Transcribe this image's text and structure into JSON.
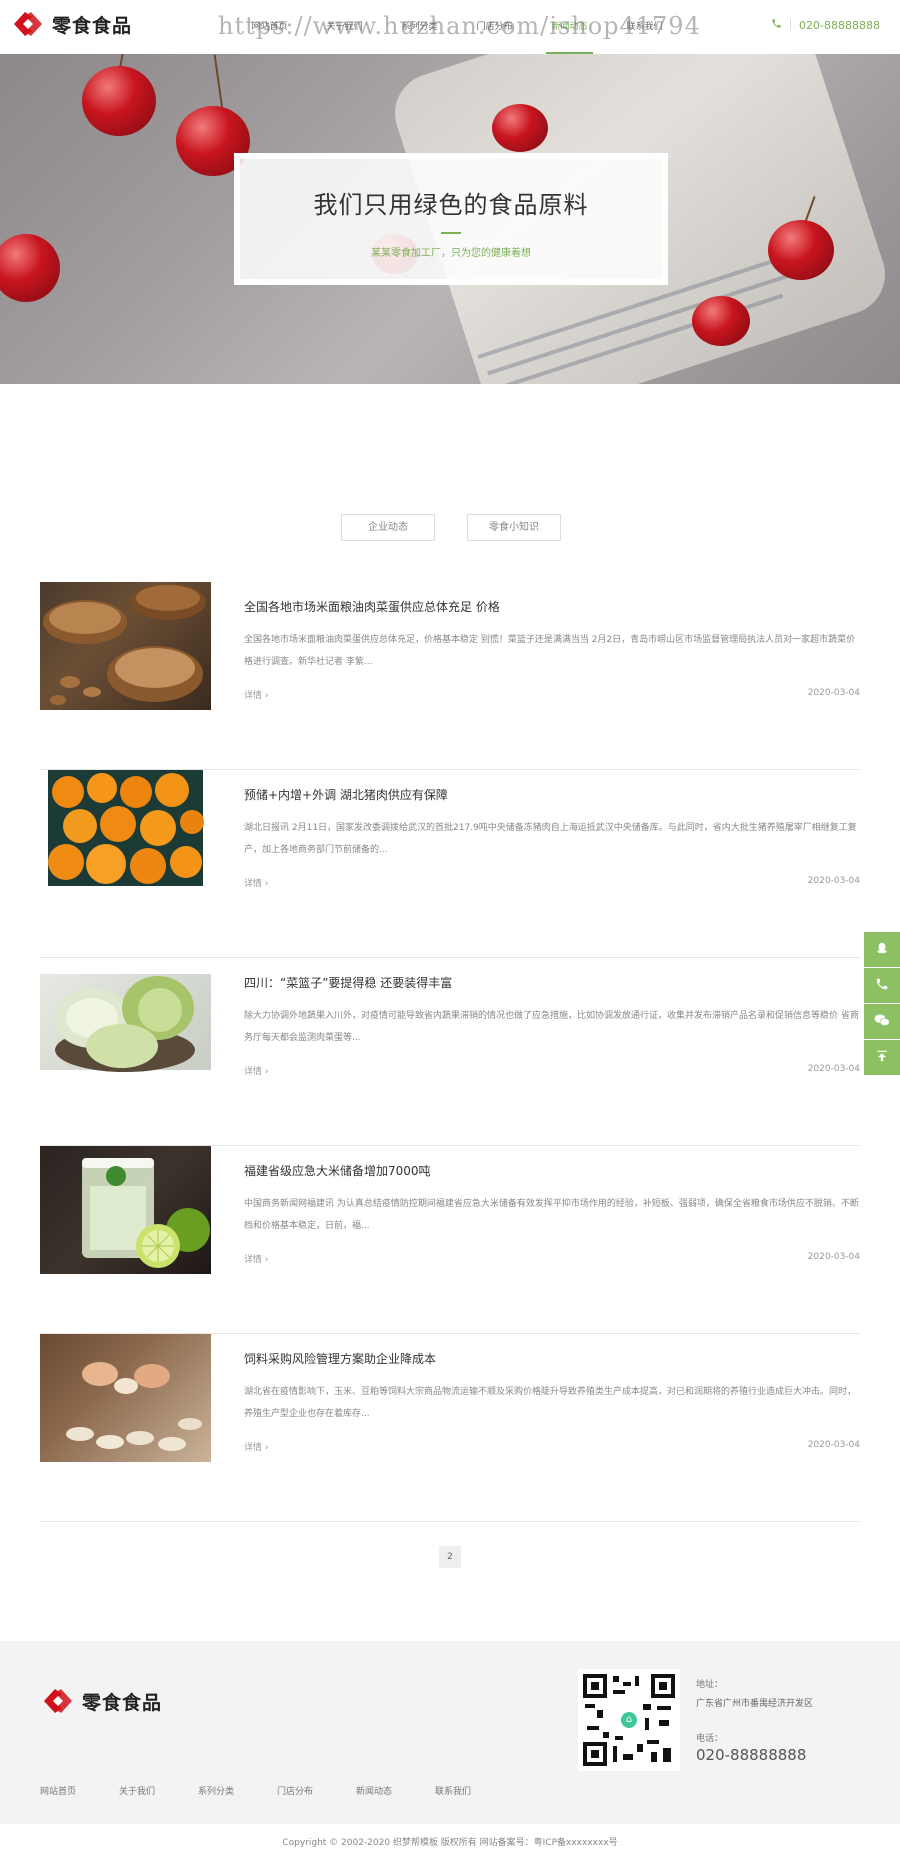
{
  "header": {
    "logo_text": "零食食品",
    "nav": [
      "网站首页",
      "关于我们",
      "系列分类",
      "门店分布",
      "新闻动态",
      "联系我们"
    ],
    "active_nav_index": 4,
    "watermark": "https://www.huzhan.com/ishop41794",
    "phone": "020-88888888"
  },
  "banner": {
    "title": "我们只用绿色的食品原料",
    "subtitle": "某某零食加工厂，只为您的健康着想"
  },
  "tabs": [
    "企业动态",
    "零食小知识"
  ],
  "news": [
    {
      "title": "全国各地市场米面粮油肉菜蛋供应总体充足 价格",
      "desc": "全国各地市场米面粮油肉菜蛋供应总体充足，价格基本稳定 别慌！菜篮子还是满满当当 2月2日，青岛市崂山区市场监督管理局执法人员对一家超市蔬菜价格进行调查。新华社记者 李紫...",
      "more": "详情",
      "date": "2020-03-04",
      "thumb": "nuts"
    },
    {
      "title": "预储+内增+外调 湖北猪肉供应有保障",
      "desc": "湖北日报讯 2月11日，国家发改委调拨给武汉的首批217.9吨中央储备冻猪肉自上海运抵武汉中央储备库。与此同时，省内大批生猪养殖屠宰厂相继复工复产，加上各地商务部门节前储备的...",
      "more": "详情",
      "date": "2020-03-04",
      "thumb": "orange"
    },
    {
      "title": "四川：“菜篮子”要提得稳 还要装得丰富",
      "desc": "除大力协调外地蔬果入川外，对疫情可能导致省内蔬果滞销的情况也做了应急措施，比如协调发放通行证，收集并发布滞销产品名录和促销信息等稳价 省商务厅每天都会监测肉菜蛋等...",
      "more": "详情",
      "date": "2020-03-04",
      "thumb": "cabbage"
    },
    {
      "title": "福建省级应急大米储备增加7000吨",
      "desc": "中国商务新闻网福建讯 为认真总结疫情防控期间福建省应急大米储备有效发挥平抑市场作用的经验，补短板、强弱项，确保全省粮食市场供应不脱销、不断档和价格基本稳定，日前，福...",
      "more": "详情",
      "date": "2020-03-04",
      "thumb": "drink"
    },
    {
      "title": "饲料采购风险管理方案助企业降成本",
      "desc": "湖北省在疫情影响下，玉米、豆粕等饲料大宗商品物流运输不顺及采购价格陡升导致养殖类生产成本提高，对已和润期将的养殖行业造成巨大冲击。同时，养殖生产型企业也存在着库存...",
      "more": "详情",
      "date": "2020-03-04",
      "thumb": "dough"
    }
  ],
  "pagination": {
    "current": "2"
  },
  "side_float": {
    "icons": [
      "qq-icon",
      "phone-icon",
      "wechat-icon",
      "back-to-top-icon"
    ]
  },
  "footer": {
    "logo_text": "零食食品",
    "links": [
      "网站首页",
      "关于我们",
      "系列分类",
      "门店分布",
      "新闻动态",
      "联系我们"
    ],
    "address_label": "地址：",
    "address": "广东省广州市番禺经济开发区",
    "phone_label": "电话：",
    "phone": "020-88888888",
    "copyright": "Copyright © 2002-2020 织梦帮模板 版权所有 网站备案号：粤ICP备xxxxxxxx号"
  },
  "colors": {
    "accent": "#7ab055",
    "side_float": "#8cc063",
    "logo_red": "#d0121b"
  }
}
